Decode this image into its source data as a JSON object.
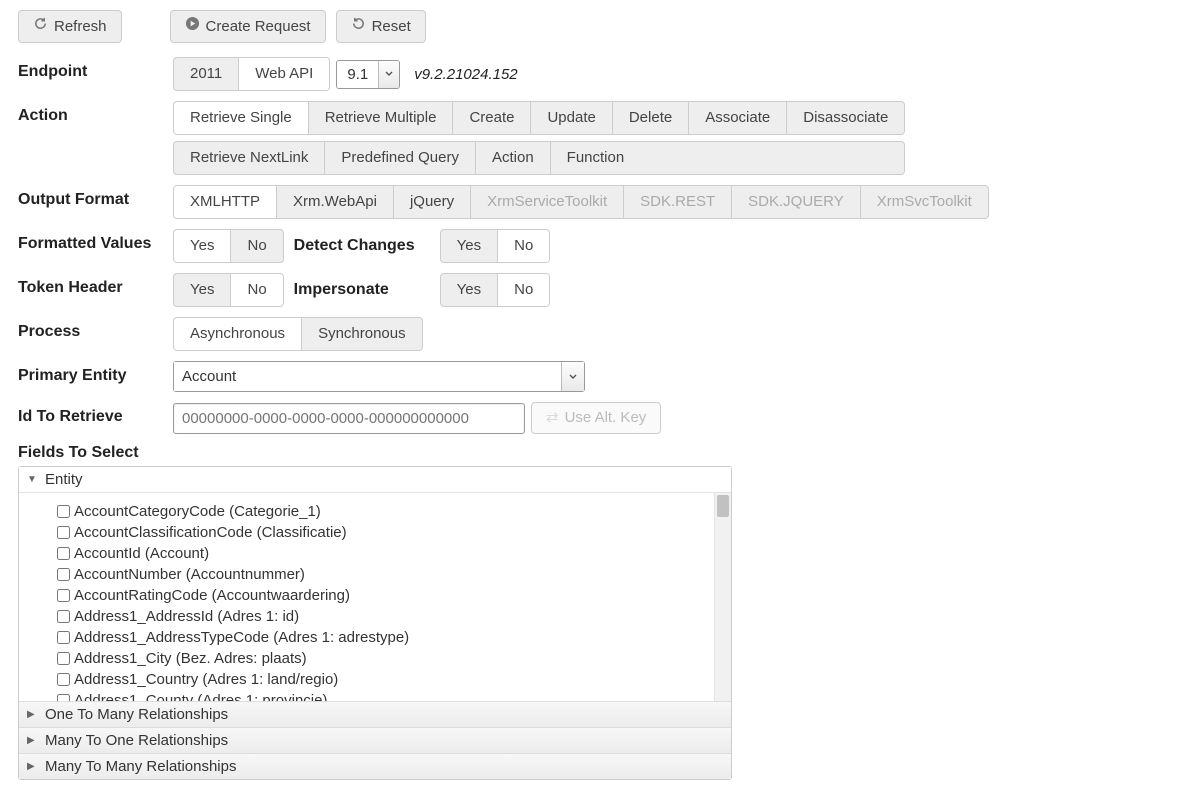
{
  "toolbar": {
    "refresh": "Refresh",
    "create_request": "Create Request",
    "reset": "Reset"
  },
  "endpoint": {
    "label": "Endpoint",
    "options": [
      "2011",
      "Web API"
    ],
    "active": "Web API",
    "version_value": "9.1",
    "version_text": "v9.2.21024.152"
  },
  "action": {
    "label": "Action",
    "row1": [
      "Retrieve Single",
      "Retrieve Multiple",
      "Create",
      "Update",
      "Delete",
      "Associate",
      "Disassociate"
    ],
    "row2": [
      "Retrieve NextLink",
      "Predefined Query",
      "Action",
      "Function"
    ],
    "active": "Retrieve Single"
  },
  "output_format": {
    "label": "Output Format",
    "options": [
      "XMLHTTP",
      "Xrm.WebApi",
      "jQuery",
      "XrmServiceToolkit",
      "SDK.REST",
      "SDK.JQUERY",
      "XrmSvcToolkit"
    ],
    "active": "XMLHTTP",
    "disabled": [
      "XrmServiceToolkit",
      "SDK.REST",
      "SDK.JQUERY",
      "XrmSvcToolkit"
    ]
  },
  "formatted_values": {
    "label": "Formatted Values",
    "options": [
      "Yes",
      "No"
    ],
    "active": "Yes"
  },
  "detect_changes": {
    "label": "Detect Changes",
    "options": [
      "Yes",
      "No"
    ],
    "active": "No"
  },
  "token_header": {
    "label": "Token Header",
    "options": [
      "Yes",
      "No"
    ],
    "active": "No"
  },
  "impersonate": {
    "label": "Impersonate",
    "options": [
      "Yes",
      "No"
    ],
    "active": "No"
  },
  "process": {
    "label": "Process",
    "options": [
      "Asynchronous",
      "Synchronous"
    ],
    "active": "Asynchronous"
  },
  "primary_entity": {
    "label": "Primary Entity",
    "value": "Account"
  },
  "id_to_retrieve": {
    "label": "Id To Retrieve",
    "placeholder": "00000000-0000-0000-0000-000000000000",
    "alt_key": "Use Alt. Key"
  },
  "fields": {
    "label": "Fields To Select",
    "accordion": [
      "Entity",
      "One To Many Relationships",
      "Many To One Relationships",
      "Many To Many Relationships"
    ],
    "items": [
      "AccountCategoryCode (Categorie_1)",
      "AccountClassificationCode (Classificatie)",
      "AccountId (Account)",
      "AccountNumber (Accountnummer)",
      "AccountRatingCode (Accountwaardering)",
      "Address1_AddressId (Adres 1: id)",
      "Address1_AddressTypeCode (Adres 1: adrestype)",
      "Address1_City (Bez. Adres: plaats)",
      "Address1_Country (Adres 1: land/regio)",
      "Address1_County (Adres 1: provincie)"
    ]
  }
}
